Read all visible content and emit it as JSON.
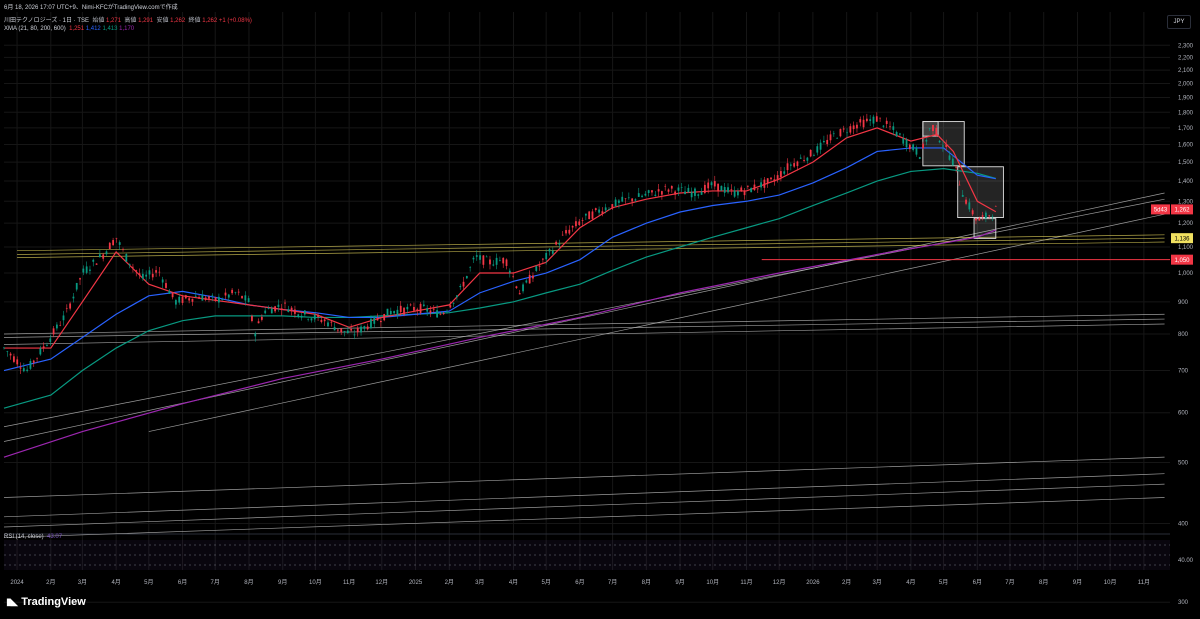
{
  "caption": "6月 18, 2026 17:07 UTC+9、Nimi-KFCがTradingView.comで作成",
  "symbol": {
    "title": "川田テクノロジーズ · 1日 · TSE",
    "open_label": "始値",
    "open": "1,271",
    "high_label": "高値",
    "high": "1,291",
    "low_label": "安値",
    "low": "1,262",
    "close_label": "終値",
    "close": "1,262",
    "change": "+1 (+0.08%)"
  },
  "indicator": {
    "label": "XMA (21, 80, 200, 600)",
    "values": [
      "1,251",
      "1,412",
      "1,413",
      "1,170"
    ]
  },
  "rsi": {
    "label": "RSI (14, close)",
    "value": "43.07",
    "tick": "40.00",
    "bands": [
      30,
      50,
      70
    ]
  },
  "currency": "JPY",
  "brand": "TradingView",
  "colors": {
    "background": "#000000",
    "xma21": "#f23645",
    "xma80": "#2962ff",
    "xma200": "#089981",
    "xma600": "#9c27b0",
    "rsi": "#7e57c2",
    "yellow_lines": "#f0e060",
    "support_line": "#f23645"
  },
  "chart_data": {
    "type": "candlestick",
    "y_scale": "log",
    "ylim": [
      340,
      2450
    ],
    "y_ticks": [
      "2,300",
      "2,200",
      "2,100",
      "2,000",
      "1,900",
      "1,800",
      "1,700",
      "1,600",
      "1,500",
      "1,400",
      "1,300",
      "1,200",
      "1,100",
      "1,000",
      "900",
      "800",
      "700",
      "600",
      "500",
      "400",
      "300"
    ],
    "x_ticks": [
      "2024",
      "2月",
      "3月",
      "4月",
      "5月",
      "6月",
      "7月",
      "8月",
      "9月",
      "10月",
      "11月",
      "12月",
      "2025",
      "2月",
      "3月",
      "4月",
      "5月",
      "6月",
      "7月",
      "8月",
      "9月",
      "10月",
      "11月",
      "12月",
      "2026",
      "2月",
      "3月",
      "4月",
      "5月",
      "6月",
      "7月",
      "8月",
      "9月",
      "10月",
      "11月"
    ],
    "price_labels": [
      {
        "text": "1,262",
        "value": 1262,
        "color": "#f23645"
      },
      {
        "text": "5d43",
        "value": 1262,
        "color": "#f23645",
        "role": "countdown"
      },
      {
        "text": "1,136",
        "value": 1136,
        "color": "#f0e060"
      },
      {
        "text": "1,050",
        "value": 1050,
        "color": "#f23645"
      }
    ],
    "price_path": [
      [
        "2023-12-20",
        760
      ],
      [
        "2024-01-10",
        700
      ],
      [
        "2024-01-25",
        760
      ],
      [
        "2024-02-15",
        860
      ],
      [
        "2024-03-01",
        1000
      ],
      [
        "2024-03-20",
        1070
      ],
      [
        "2024-04-01",
        1140
      ],
      [
        "2024-04-10",
        1060
      ],
      [
        "2024-04-25",
        980
      ],
      [
        "2024-05-10",
        1010
      ],
      [
        "2024-05-25",
        900
      ],
      [
        "2024-06-15",
        920
      ],
      [
        "2024-07-01",
        905
      ],
      [
        "2024-07-20",
        930
      ],
      [
        "2024-08-01",
        900
      ],
      [
        "2024-08-06",
        800
      ],
      [
        "2024-08-15",
        870
      ],
      [
        "2024-09-01",
        890
      ],
      [
        "2024-09-20",
        860
      ],
      [
        "2024-10-10",
        840
      ],
      [
        "2024-10-25",
        810
      ],
      [
        "2024-11-05",
        800
      ],
      [
        "2024-11-20",
        830
      ],
      [
        "2024-12-10",
        870
      ],
      [
        "2025-01-05",
        880
      ],
      [
        "2025-01-25",
        860
      ],
      [
        "2025-02-10",
        930
      ],
      [
        "2025-02-25",
        1060
      ],
      [
        "2025-03-10",
        1040
      ],
      [
        "2025-03-25",
        1050
      ],
      [
        "2025-04-07",
        930
      ],
      [
        "2025-04-20",
        1000
      ],
      [
        "2025-05-01",
        1060
      ],
      [
        "2025-05-20",
        1160
      ],
      [
        "2025-06-05",
        1220
      ],
      [
        "2025-06-20",
        1260
      ],
      [
        "2025-07-10",
        1300
      ],
      [
        "2025-08-01",
        1330
      ],
      [
        "2025-08-20",
        1360
      ],
      [
        "2025-09-15",
        1340
      ],
      [
        "2025-10-01",
        1380
      ],
      [
        "2025-10-20",
        1340
      ],
      [
        "2025-11-05",
        1360
      ],
      [
        "2025-11-25",
        1400
      ],
      [
        "2025-12-10",
        1480
      ],
      [
        "2026-01-01",
        1550
      ],
      [
        "2026-01-20",
        1650
      ],
      [
        "2026-02-10",
        1720
      ],
      [
        "2026-03-01",
        1760
      ],
      [
        "2026-03-15",
        1690
      ],
      [
        "2026-03-30",
        1600
      ],
      [
        "2026-04-10",
        1540
      ],
      [
        "2026-04-20",
        1720
      ],
      [
        "2026-05-01",
        1600
      ],
      [
        "2026-05-10",
        1500
      ],
      [
        "2026-05-20",
        1320
      ],
      [
        "2026-06-01",
        1210
      ],
      [
        "2026-06-10",
        1230
      ],
      [
        "2026-06-18",
        1262
      ]
    ],
    "xma21": [
      [
        "2023-12-20",
        760
      ],
      [
        "2024-02-01",
        760
      ],
      [
        "2024-03-01",
        900
      ],
      [
        "2024-04-01",
        1080
      ],
      [
        "2024-05-01",
        960
      ],
      [
        "2024-06-01",
        920
      ],
      [
        "2024-07-01",
        905
      ],
      [
        "2024-08-01",
        890
      ],
      [
        "2024-09-01",
        875
      ],
      [
        "2024-10-01",
        860
      ],
      [
        "2024-11-01",
        820
      ],
      [
        "2024-12-01",
        850
      ],
      [
        "2025-01-01",
        870
      ],
      [
        "2025-02-01",
        890
      ],
      [
        "2025-03-01",
        1000
      ],
      [
        "2025-04-01",
        1000
      ],
      [
        "2025-05-01",
        1040
      ],
      [
        "2025-06-01",
        1180
      ],
      [
        "2025-07-01",
        1270
      ],
      [
        "2025-08-01",
        1310
      ],
      [
        "2025-09-01",
        1340
      ],
      [
        "2025-10-01",
        1350
      ],
      [
        "2025-11-01",
        1350
      ],
      [
        "2025-12-01",
        1410
      ],
      [
        "2026-01-01",
        1500
      ],
      [
        "2026-02-01",
        1640
      ],
      [
        "2026-03-01",
        1700
      ],
      [
        "2026-04-01",
        1620
      ],
      [
        "2026-04-25",
        1660
      ],
      [
        "2026-05-10",
        1560
      ],
      [
        "2026-06-01",
        1300
      ],
      [
        "2026-06-18",
        1251
      ]
    ],
    "xma80": [
      [
        "2023-12-20",
        700
      ],
      [
        "2024-02-01",
        730
      ],
      [
        "2024-03-01",
        790
      ],
      [
        "2024-04-01",
        860
      ],
      [
        "2024-05-01",
        920
      ],
      [
        "2024-06-01",
        935
      ],
      [
        "2024-07-01",
        915
      ],
      [
        "2024-08-01",
        890
      ],
      [
        "2024-09-01",
        875
      ],
      [
        "2024-10-01",
        865
      ],
      [
        "2024-11-01",
        850
      ],
      [
        "2024-12-01",
        850
      ],
      [
        "2025-01-01",
        860
      ],
      [
        "2025-02-01",
        870
      ],
      [
        "2025-03-01",
        930
      ],
      [
        "2025-04-01",
        970
      ],
      [
        "2025-05-01",
        1000
      ],
      [
        "2025-06-01",
        1050
      ],
      [
        "2025-07-01",
        1140
      ],
      [
        "2025-08-01",
        1200
      ],
      [
        "2025-09-01",
        1250
      ],
      [
        "2025-10-01",
        1280
      ],
      [
        "2025-11-01",
        1300
      ],
      [
        "2025-12-01",
        1330
      ],
      [
        "2026-01-01",
        1390
      ],
      [
        "2026-02-01",
        1470
      ],
      [
        "2026-03-01",
        1560
      ],
      [
        "2026-04-01",
        1580
      ],
      [
        "2026-05-01",
        1580
      ],
      [
        "2026-06-01",
        1430
      ],
      [
        "2026-06-18",
        1412
      ]
    ],
    "xma200": [
      [
        "2023-12-20",
        610
      ],
      [
        "2024-02-01",
        640
      ],
      [
        "2024-03-01",
        700
      ],
      [
        "2024-04-01",
        760
      ],
      [
        "2024-05-01",
        810
      ],
      [
        "2024-06-01",
        840
      ],
      [
        "2024-07-01",
        855
      ],
      [
        "2024-08-01",
        855
      ],
      [
        "2024-09-01",
        855
      ],
      [
        "2024-10-01",
        850
      ],
      [
        "2024-11-01",
        850
      ],
      [
        "2024-12-01",
        855
      ],
      [
        "2025-01-01",
        860
      ],
      [
        "2025-02-01",
        865
      ],
      [
        "2025-03-01",
        880
      ],
      [
        "2025-04-01",
        900
      ],
      [
        "2025-05-01",
        930
      ],
      [
        "2025-06-01",
        960
      ],
      [
        "2025-07-01",
        1010
      ],
      [
        "2025-08-01",
        1060
      ],
      [
        "2025-09-01",
        1100
      ],
      [
        "2025-10-01",
        1140
      ],
      [
        "2025-11-01",
        1180
      ],
      [
        "2025-12-01",
        1220
      ],
      [
        "2026-01-01",
        1280
      ],
      [
        "2026-02-01",
        1340
      ],
      [
        "2026-03-01",
        1400
      ],
      [
        "2026-04-01",
        1450
      ],
      [
        "2026-05-01",
        1465
      ],
      [
        "2026-06-01",
        1440
      ],
      [
        "2026-06-18",
        1413
      ]
    ],
    "xma600": [
      [
        "2023-12-20",
        510
      ],
      [
        "2024-03-01",
        560
      ],
      [
        "2024-06-01",
        620
      ],
      [
        "2024-09-01",
        680
      ],
      [
        "2024-12-01",
        730
      ],
      [
        "2025-03-01",
        790
      ],
      [
        "2025-06-01",
        850
      ],
      [
        "2025-09-01",
        930
      ],
      [
        "2025-12-01",
        1000
      ],
      [
        "2026-03-01",
        1070
      ],
      [
        "2026-06-01",
        1140
      ],
      [
        "2026-06-18",
        1170
      ]
    ],
    "trendlines": [
      {
        "from": [
          "2023-12-20",
          540
        ],
        "to": [
          "2026-11-20",
          1340
        ],
        "color": "#cfcfcf"
      },
      {
        "from": [
          "2023-12-20",
          570
        ],
        "to": [
          "2026-11-20",
          1310
        ],
        "color": "#cfcfcf"
      },
      {
        "from": [
          "2024-05-01",
          560
        ],
        "to": [
          "2026-11-20",
          1240
        ],
        "color": "#cfcfcf"
      },
      {
        "from": [
          "2023-12-20",
          800
        ],
        "to": [
          "2026-11-20",
          860
        ],
        "color": "#cfcfcf"
      },
      {
        "from": [
          "2023-12-20",
          790
        ],
        "to": [
          "2026-11-20",
          845
        ],
        "color": "#cfcfcf"
      },
      {
        "from": [
          "2023-12-20",
          770
        ],
        "to": [
          "2026-11-20",
          830
        ],
        "color": "#cfcfcf"
      },
      {
        "from": [
          "2023-12-20",
          440
        ],
        "to": [
          "2026-11-20",
          510
        ],
        "color": "#cfcfcf"
      },
      {
        "from": [
          "2023-12-20",
          410
        ],
        "to": [
          "2026-11-20",
          480
        ],
        "color": "#cfcfcf"
      },
      {
        "from": [
          "2023-12-20",
          395
        ],
        "to": [
          "2026-11-20",
          462
        ],
        "color": "#cfcfcf"
      },
      {
        "from": [
          "2023-12-20",
          380
        ],
        "to": [
          "2026-11-20",
          440
        ],
        "color": "#cfcfcf"
      },
      {
        "from": [
          "2024-01-01",
          1085
        ],
        "to": [
          "2026-11-20",
          1150
        ],
        "color": "#f0e060"
      },
      {
        "from": [
          "2024-01-01",
          1070
        ],
        "to": [
          "2026-11-20",
          1136
        ],
        "color": "#f0e060"
      },
      {
        "from": [
          "2024-01-01",
          1058
        ],
        "to": [
          "2026-11-20",
          1120
        ],
        "color": "#f0e060"
      }
    ],
    "hlines": [
      {
        "value": 1050,
        "from": "2025-11-15",
        "color": "#f23645"
      }
    ],
    "boxes": [
      {
        "from": "2026-04-12",
        "to": "2026-05-20",
        "low": 1480,
        "high": 1740
      },
      {
        "from": "2026-04-12",
        "to": "2026-04-26",
        "low": 1650,
        "high": 1740
      },
      {
        "from": "2026-05-14",
        "to": "2026-06-25",
        "low": 1225,
        "high": 1475
      },
      {
        "from": "2026-05-29",
        "to": "2026-06-18",
        "low": 1135,
        "high": 1220
      }
    ],
    "x_range": [
      "2023-12-20",
      "2026-11-25"
    ]
  }
}
